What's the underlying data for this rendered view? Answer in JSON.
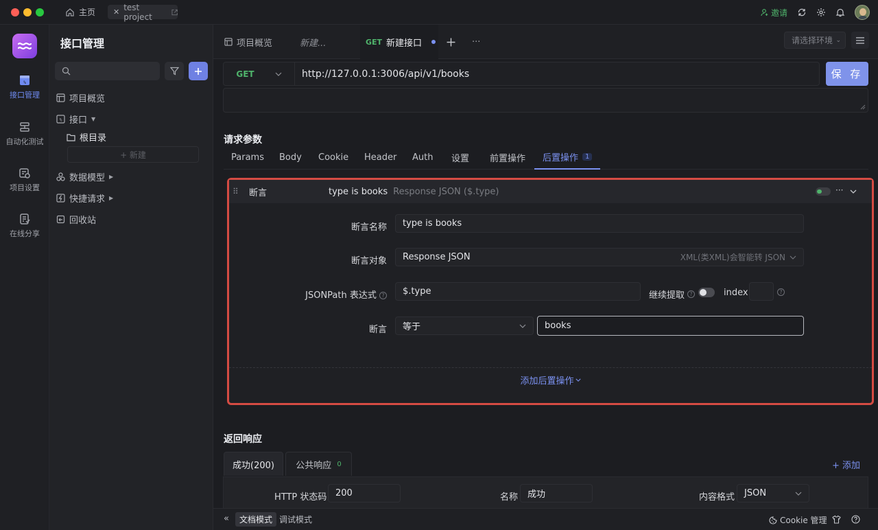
{
  "titlebar": {
    "home_label": "主页",
    "project_tab": "test project",
    "invite_label": "邀请"
  },
  "rail": {
    "items": [
      {
        "label": "接口管理",
        "icon": "api-icon",
        "active": true
      },
      {
        "label": "自动化测试",
        "icon": "automation-icon",
        "active": false
      },
      {
        "label": "项目设置",
        "icon": "project-settings-icon",
        "active": false
      },
      {
        "label": "在线分享",
        "icon": "share-icon",
        "active": false
      }
    ]
  },
  "sidebar": {
    "title": "接口管理",
    "items": [
      {
        "label": "项目概览",
        "icon": "overview-icon"
      },
      {
        "label": "接口",
        "icon": "api-folder-icon"
      },
      {
        "label": "根目录",
        "icon": "folder-icon"
      },
      {
        "label": "数据模型",
        "icon": "data-model-icon"
      },
      {
        "label": "快捷请求",
        "icon": "quick-request-icon"
      },
      {
        "label": "回收站",
        "icon": "trash-icon"
      }
    ],
    "new_label": "+ 新建"
  },
  "tabs": {
    "overview": "项目概览",
    "draft": "新建...",
    "active_method": "GET",
    "active_label": "新建接口",
    "env_placeholder": "请选择环境"
  },
  "request": {
    "method": "GET",
    "url": "http://127.0.0.1:3006/api/v1/books",
    "save_label": "保 存"
  },
  "params": {
    "section_title": "请求参数",
    "tabs": [
      "Params",
      "Body",
      "Cookie",
      "Header",
      "Auth",
      "设置",
      "前置操作",
      "后置操作"
    ],
    "active_index": 7,
    "active_badge": "1"
  },
  "assertion": {
    "type_label": "断言",
    "summary_name": "type is books",
    "summary_target": "Response JSON ($.type)",
    "name_label": "断言名称",
    "name_value": "type is books",
    "target_label": "断言对象",
    "target_value": "Response JSON",
    "target_hint": "XML(类XML)会智能转 JSON",
    "jsonpath_label": "JSONPath 表达式",
    "jsonpath_value": "$.type",
    "continue_label": "继续提取",
    "index_label": "index",
    "assert_label": "断言",
    "operator": "等于",
    "expected": "books",
    "add_post_label": "添加后置操作"
  },
  "response": {
    "section_title": "返回响应",
    "tab_success": "成功(200)",
    "tab_common": "公共响应",
    "tab_common_badge": "0",
    "add_label": "+ 添加",
    "status_label": "HTTP 状态码",
    "status_value": "200",
    "name_label": "名称",
    "name_value": "成功",
    "format_label": "内容格式",
    "format_value": "JSON"
  },
  "bottombar": {
    "doc_mode": "文档模式",
    "debug_mode": "调试模式",
    "cookie_label": "Cookie 管理"
  },
  "colors": {
    "accent": "#7b91f0",
    "success": "#4fb36b",
    "highlight_border": "#d54b43"
  }
}
